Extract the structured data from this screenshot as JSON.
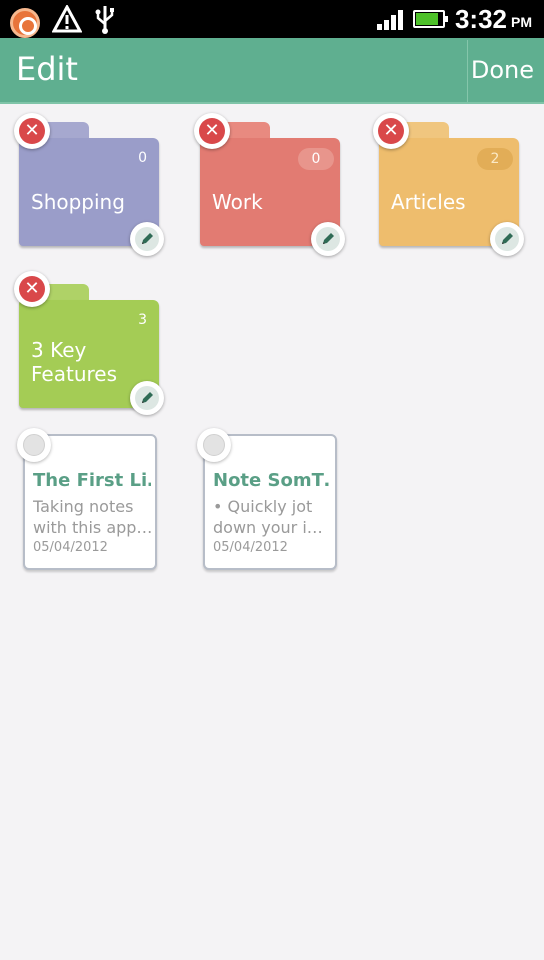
{
  "status_bar": {
    "time": "3:32",
    "ampm": "PM",
    "left_icons": [
      "app-notification-icon",
      "warning-icon",
      "usb-icon"
    ],
    "right_icons": [
      "signal-icon",
      "battery-charging-icon"
    ]
  },
  "app_bar": {
    "title": "Edit",
    "done_label": "Done"
  },
  "folders": [
    {
      "name_lines": [
        "Shopping"
      ],
      "count": "0",
      "color": "#9a9dc9",
      "tab_color": "#a6a8cf"
    },
    {
      "name_lines": [
        "Work"
      ],
      "count": "0",
      "color": "#e27b72",
      "tab_color": "#e88a80"
    },
    {
      "name_lines": [
        "Articles"
      ],
      "count": "2",
      "color": "#eebd6d",
      "tab_color": "#f0c67f"
    },
    {
      "name_lines": [
        "3 Key",
        "Features"
      ],
      "count": "3",
      "color": "#a4cc55",
      "tab_color": "#afd267"
    }
  ],
  "notes": [
    {
      "title": "The First Li…",
      "preview_lines": [
        "Taking notes",
        "with this app…"
      ],
      "date": "05/04/2012"
    },
    {
      "title": "Note SomT…",
      "preview_lines": [
        "• Quickly jot",
        "down your i…"
      ],
      "date": "05/04/2012"
    }
  ],
  "icons": {
    "delete": "delete-icon",
    "edit": "pencil-icon",
    "select": "select-circle-icon"
  }
}
